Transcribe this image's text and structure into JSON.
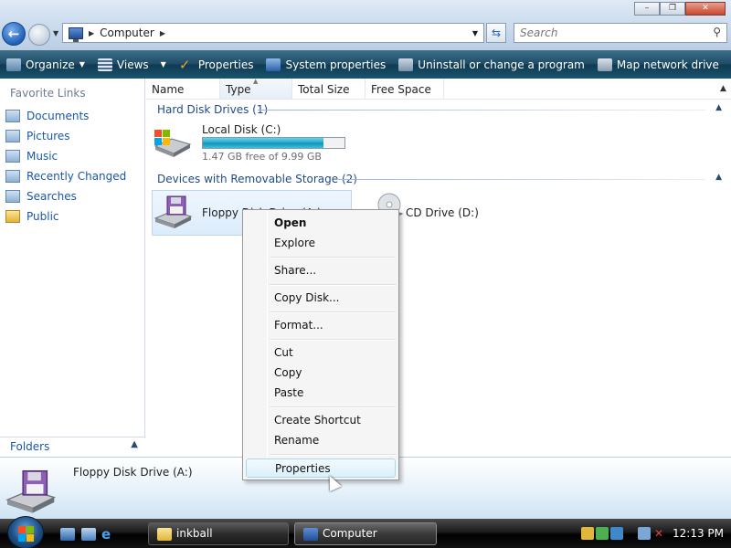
{
  "window": {
    "controls": [
      "–",
      "❐",
      "✕"
    ]
  },
  "address": {
    "breadcrumb": "Computer",
    "search_placeholder": "Search"
  },
  "toolbar": {
    "organize": "Organize",
    "views": "Views",
    "properties": "Properties",
    "system_properties": "System properties",
    "uninstall": "Uninstall or change a program",
    "map_drive": "Map network drive",
    "more": "»"
  },
  "sidebar": {
    "header": "Favorite Links",
    "items": [
      {
        "label": "Documents",
        "icon": "documents-icon"
      },
      {
        "label": "Pictures",
        "icon": "pictures-icon"
      },
      {
        "label": "Music",
        "icon": "music-icon"
      },
      {
        "label": "Recently Changed",
        "icon": "recent-icon"
      },
      {
        "label": "Searches",
        "icon": "searches-icon"
      },
      {
        "label": "Public",
        "icon": "public-folder-icon"
      }
    ],
    "folders_label": "Folders"
  },
  "columns": [
    "Name",
    "Type",
    "Total Size",
    "Free Space"
  ],
  "groups": {
    "hdd": "Hard Disk Drives (1)",
    "removable": "Devices with Removable Storage (2)"
  },
  "drives": {
    "local_name": "Local Disk (C:)",
    "local_free": "1.47 GB free of 9.99 GB",
    "local_used_fraction": 0.853,
    "floppy_name": "Floppy Disk Drive (A:)",
    "cd_name": "CD Drive (D:)"
  },
  "context_menu": {
    "items": [
      "Open",
      "Explore",
      "Share...",
      "Copy Disk...",
      "Format...",
      "Cut",
      "Copy",
      "Paste",
      "Create Shortcut",
      "Rename",
      "Properties"
    ]
  },
  "details": {
    "selected_name": "Floppy Disk Drive (A:)"
  },
  "taskbar": {
    "buttons": [
      "inkball",
      "Computer"
    ],
    "clock": "12:13 PM"
  },
  "colors": {
    "link_blue": "#1a57a8",
    "group_blue": "#1e4a8a",
    "progress_fill": "#1ea7c8"
  }
}
